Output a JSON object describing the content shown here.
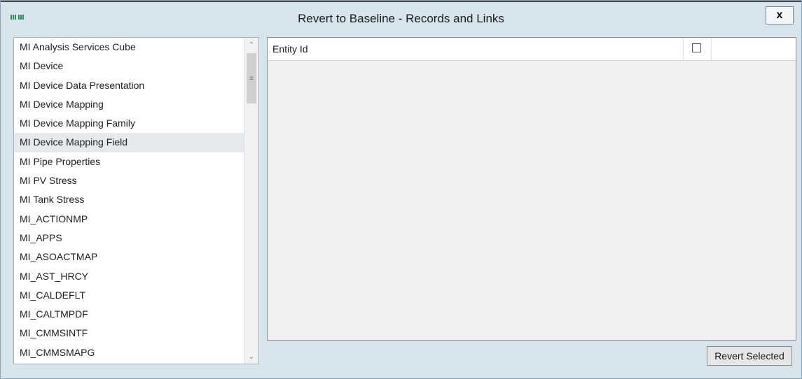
{
  "window": {
    "title": "Revert to Baseline - Records and Links",
    "close_label": "x"
  },
  "icons": {
    "app_icon": "app-logo-icon",
    "close": "close-icon",
    "scroll_up": "chevron-up-icon",
    "scroll_down": "chevron-down-icon"
  },
  "families_list": {
    "items": [
      "MI Analysis Services Cube",
      "MI Device",
      "MI Device Data Presentation",
      "MI Device Mapping",
      "MI Device Mapping Family",
      "MI Device Mapping Field",
      "MI Pipe Properties",
      "MI PV Stress",
      "MI Tank Stress",
      "MI_ACTIONMP",
      "MI_APPS",
      "MI_ASOACTMAP",
      "MI_AST_HRCY",
      "MI_CALDEFLT",
      "MI_CALTMPDF",
      "MI_CMMSINTF",
      "MI_CMMSMAPG"
    ],
    "selected": "MI Device Mapping Field"
  },
  "grid": {
    "columns": [
      "Entity Id"
    ],
    "select_all_checked": false
  },
  "actions": {
    "revert_selected_label": "Revert Selected"
  },
  "colors": {
    "window_bg": "#d7e4ec",
    "grid_bg": "#f0f0f0",
    "selected_row": "#e7e9ec"
  }
}
